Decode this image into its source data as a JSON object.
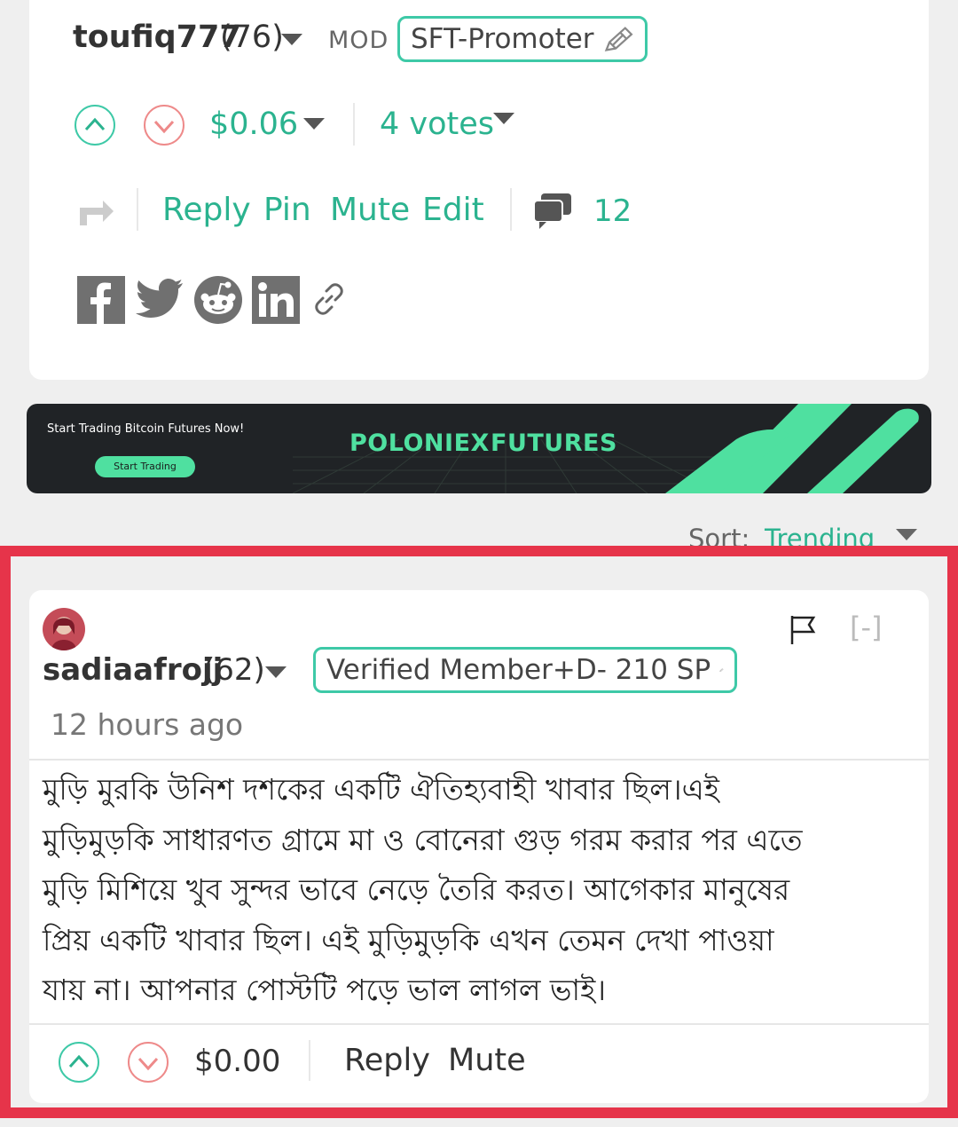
{
  "top_comment": {
    "username": "toufiq777",
    "reputation": "(76)",
    "role": "MOD",
    "badge": "SFT-Promoter",
    "payout": "$0.06",
    "votes": "4 votes",
    "actions": {
      "reply": "Reply",
      "pin": "Pin",
      "mute": "Mute",
      "edit": "Edit"
    },
    "reply_count": "12",
    "share_icons": [
      "facebook-icon",
      "twitter-icon",
      "reddit-icon",
      "linkedin-icon",
      "link-icon"
    ]
  },
  "ad": {
    "tagline": "Start Trading Bitcoin Futures Now!",
    "button": "Start Trading",
    "brand": "POLONIEX",
    "brand_suffix": "FUTURES",
    "colors": {
      "accent": "#4fe0a0",
      "background": "#202326"
    }
  },
  "sort": {
    "label": "Sort:",
    "value": "Trending"
  },
  "comment": {
    "username": "sadiaafrojj",
    "reputation": "(62)",
    "badge": "Verified Member+D- 210 SP",
    "time": "12 hours ago",
    "collapse": "[-]",
    "body_lines": [
      "মুড়ি মুরকি উনিশ দশকের একটি ঐতিহ্যবাহী খাবার ছিল।এই",
      "মুড়িমুড়কি সাধারণত গ্রামে মা ও বোনেরা গুড় গরম করার পর এতে",
      "মুড়ি মিশিয়ে খুব সুন্দর ভাবে নেড়ে তৈরি করত। আগেকার মানুষের",
      "প্রিয় একটি খাবার ছিল। এই মুড়িমুড়কি এখন তেমন দেখা পাওয়া",
      "যায় না। আপনার পোস্টটি পড়ে ভাল লাগল ভাই।"
    ],
    "payout": "$0.00",
    "actions": {
      "reply": "Reply",
      "mute": "Mute"
    }
  },
  "colors": {
    "accent": "#2bb38f",
    "highlight": "#e6344a",
    "downvote": "#ee8a8a"
  }
}
